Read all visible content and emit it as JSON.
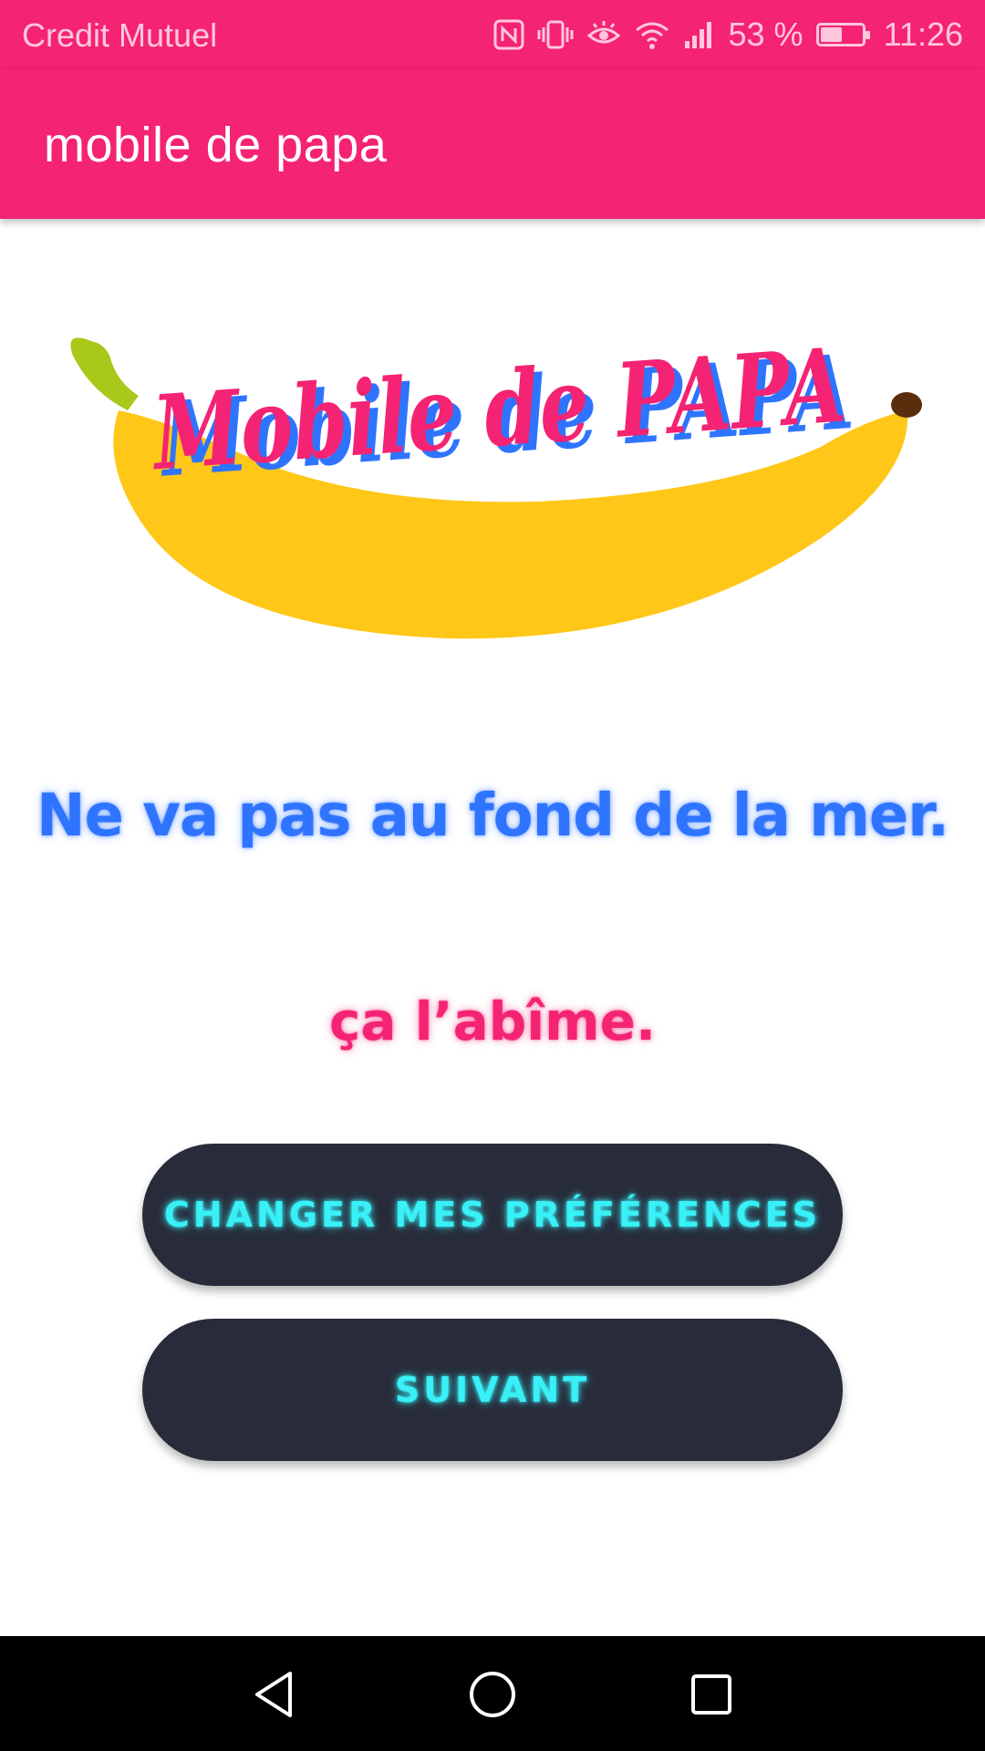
{
  "status_bar": {
    "carrier": "Credit Mutuel",
    "battery_percent_text": "53 %",
    "battery_level": 0.53,
    "time": "11:26",
    "icons": [
      "nfc-icon",
      "vibrate-icon",
      "eye-comfort-icon",
      "wifi-icon",
      "signal-icon",
      "battery-icon"
    ]
  },
  "app_bar": {
    "title": "mobile de papa"
  },
  "logo": {
    "text": "Mobile de PAPA",
    "colors": {
      "banana": "#ffc718",
      "stem": "#a8c81a",
      "tip": "#5a2e0c",
      "text": "#f42373",
      "text_shadow": "#2f74ff"
    }
  },
  "quote": {
    "line1": "Ne va pas au fond de la mer.",
    "line2": "ça l’abîme."
  },
  "buttons": {
    "preferences_label": "CHANGER MES PRÉFÉRENCES",
    "next_label": "SUIVANT"
  },
  "nav_bar": {
    "icons": [
      "back-icon",
      "home-icon",
      "recent-apps-icon"
    ]
  },
  "colors": {
    "primary": "#f42373",
    "accent_blue": "#2f74ff",
    "button_bg": "#282b3a",
    "button_text": "#39f0f7"
  }
}
